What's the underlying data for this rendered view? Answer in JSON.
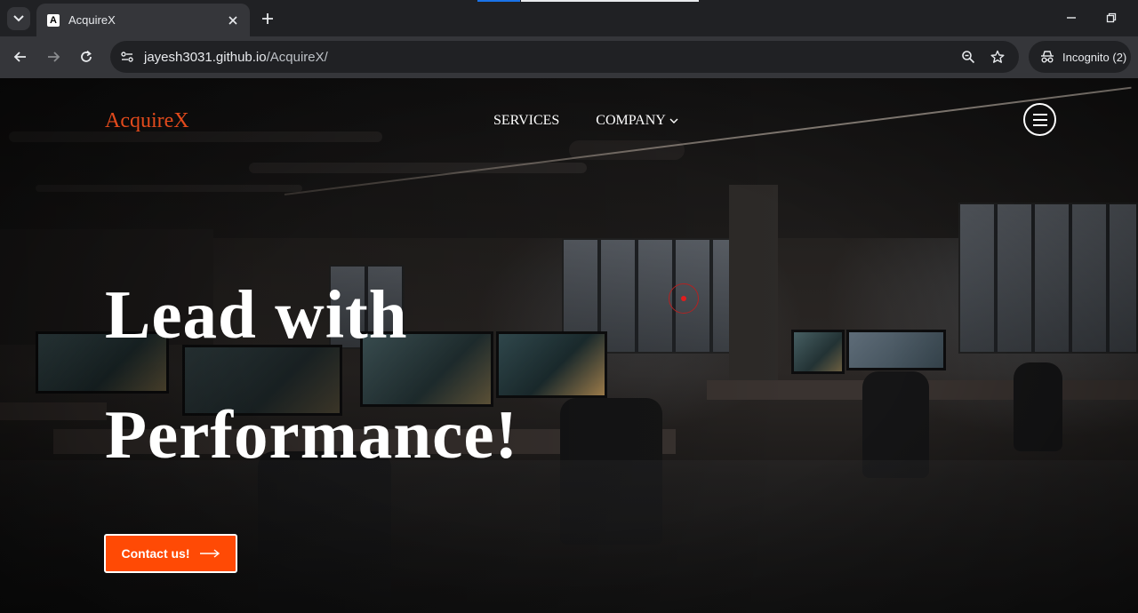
{
  "browser": {
    "tab": {
      "favicon_letter": "A",
      "title": "AcquireX"
    },
    "url": {
      "host": "jayesh3031.github.io",
      "path": "/AcquireX/"
    },
    "incognito_label": "Incognito (2)"
  },
  "site": {
    "logo": "AcquireX",
    "nav": [
      {
        "label": "SERVICES"
      },
      {
        "label": "COMPANY",
        "chevron": "⌵"
      }
    ],
    "hero": {
      "line1": "Lead with",
      "line2": "Performance!"
    },
    "cta": {
      "label": "Contact us!"
    },
    "colors": {
      "accent": "#ff4a05",
      "logo": "#e24a1c"
    }
  }
}
